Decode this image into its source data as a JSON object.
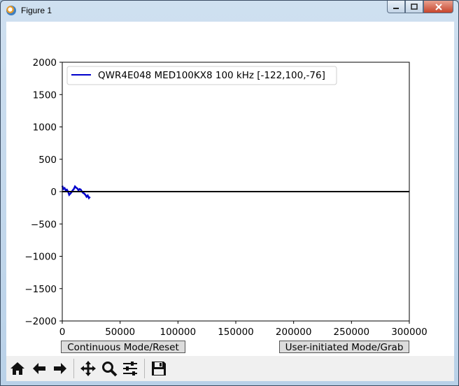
{
  "window": {
    "title": "Figure 1"
  },
  "chart_data": {
    "type": "line",
    "xlim": [
      0,
      300000
    ],
    "ylim": [
      -2000,
      2000
    ],
    "xticks": [
      "0",
      "50000",
      "100000",
      "150000",
      "200000",
      "250000",
      "300000"
    ],
    "yticks": [
      "2000",
      "1500",
      "1000",
      "500",
      "0",
      "−500",
      "−1000",
      "−1500",
      "−2000"
    ],
    "legend": {
      "location": "upper-left"
    },
    "series": [
      {
        "name": "QWR4E048 MED100KX8 100 kHz [-122,100,-76]",
        "color": "#0000cc",
        "x": [
          0,
          1000,
          2000,
          3000,
          4000,
          5000,
          6000,
          7000,
          8000,
          9000,
          10000,
          11000,
          12000,
          13000,
          14000,
          15000,
          16000,
          17000,
          18000,
          19000,
          20000,
          21000,
          22000,
          23000,
          24000
        ],
        "y": [
          90,
          40,
          55,
          20,
          30,
          0,
          -50,
          -30,
          -10,
          20,
          40,
          80,
          60,
          50,
          20,
          40,
          30,
          0,
          -20,
          -30,
          -50,
          -80,
          -60,
          -100,
          -80
        ]
      },
      {
        "name": "",
        "color": "#000000",
        "x": [
          0,
          300000
        ],
        "y": [
          0,
          0
        ]
      }
    ]
  },
  "buttons": {
    "continuous": "Continuous Mode/Reset",
    "user": "User-initiated Mode/Grab"
  },
  "toolbar": [
    {
      "icon": "home-icon"
    },
    {
      "icon": "back-arrow-icon"
    },
    {
      "icon": "forward-arrow-icon"
    },
    {
      "icon": "pan-icon"
    },
    {
      "icon": "zoom-icon"
    },
    {
      "icon": "subplots-icon"
    },
    {
      "icon": "save-icon"
    }
  ]
}
